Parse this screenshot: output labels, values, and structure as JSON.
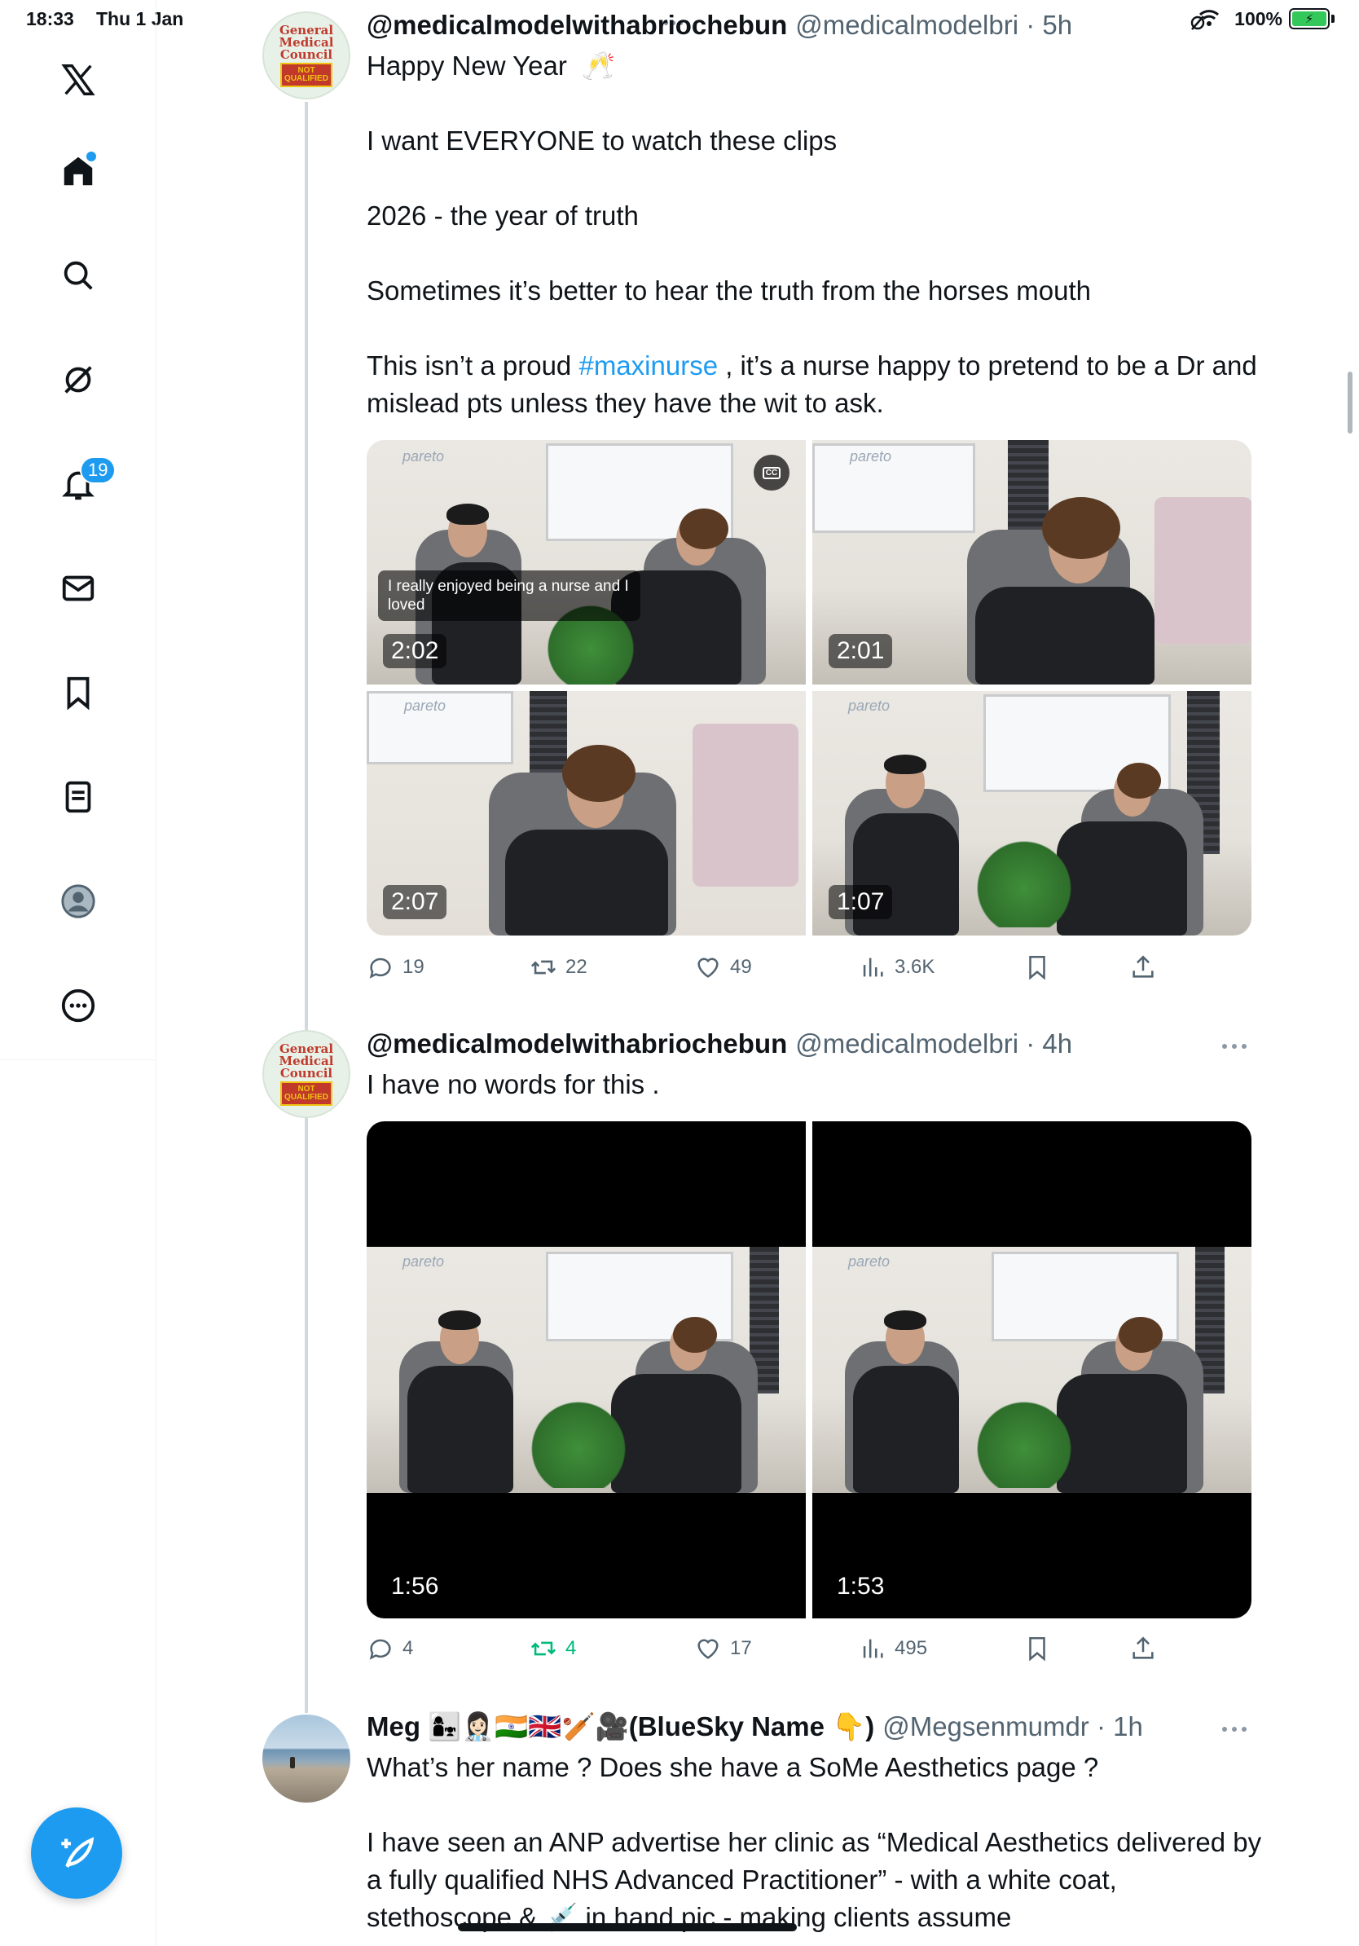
{
  "status_bar": {
    "time": "18:33",
    "date": "Thu 1 Jan",
    "battery": "100%"
  },
  "sidebar": {
    "notifications_badge": "19",
    "items": [
      "x-logo-icon",
      "home-icon",
      "search-icon",
      "grok-icon",
      "bell-icon",
      "mail-icon",
      "bookmark-icon",
      "lists-icon",
      "profile-icon",
      "more-icon"
    ]
  },
  "posts": [
    {
      "avatar_text": [
        "General",
        "Medical",
        "Council"
      ],
      "avatar_badge": "NOT QUALIFIED",
      "display_name": "@medicalmodelwithabriochebun",
      "handle": "@medicalmodelbri · 5h",
      "text_before_hashtag": "Happy New Year  🥂\n\nI want EVERYONE to watch these clips\n\n2026 - the year of truth\n\nSometimes it’s better to hear the truth from the horses mouth\n\nThis isn’t a proud ",
      "hashtag": "#maxinurse",
      "text_after_hashtag": " , it’s a nurse happy to pretend to be a Dr and mislead pts unless they have the wit to ask.",
      "media": [
        {
          "duration": "2:02",
          "caption": "I really enjoyed being a nurse and I loved",
          "logo": "pareto"
        },
        {
          "duration": "2:01",
          "logo": "pareto"
        },
        {
          "duration": "2:07",
          "logo": "pareto"
        },
        {
          "duration": "1:07",
          "logo": "pareto"
        }
      ],
      "stats": {
        "replies": "19",
        "reposts": "22",
        "likes": "49",
        "views": "3.6K"
      }
    },
    {
      "avatar_text": [
        "General",
        "Medical",
        "Council"
      ],
      "avatar_badge": "NOT QUALIFIED",
      "display_name": "@medicalmodelwithabriochebun",
      "handle": "@medicalmodelbri · 4h",
      "text": "I have no words for this .",
      "media": [
        {
          "duration": "1:56",
          "logo": "pareto"
        },
        {
          "duration": "1:53",
          "logo": "pareto"
        }
      ],
      "stats": {
        "replies": "4",
        "reposts": "4",
        "likes": "17",
        "views": "495"
      }
    },
    {
      "display_name": "Meg 👩‍👧👩🏻‍⚕️🇮🇳🇬🇧🏏🎥(BlueSky Name 👇)",
      "handle": "@Megsenmumdr · 1h",
      "text": "What’s her name ? Does she have a SoMe Aesthetics page ?\n\nI have seen an ANP advertise her clinic as “Medical Aesthetics delivered by a fully qualified NHS Advanced Practitioner” - with a white coat, stethoscope & 💉 in hand pic - making clients assume"
    }
  ],
  "colors": {
    "accent": "#1d9bf0",
    "repost_active": "#00ba7c",
    "muted": "#536471"
  }
}
